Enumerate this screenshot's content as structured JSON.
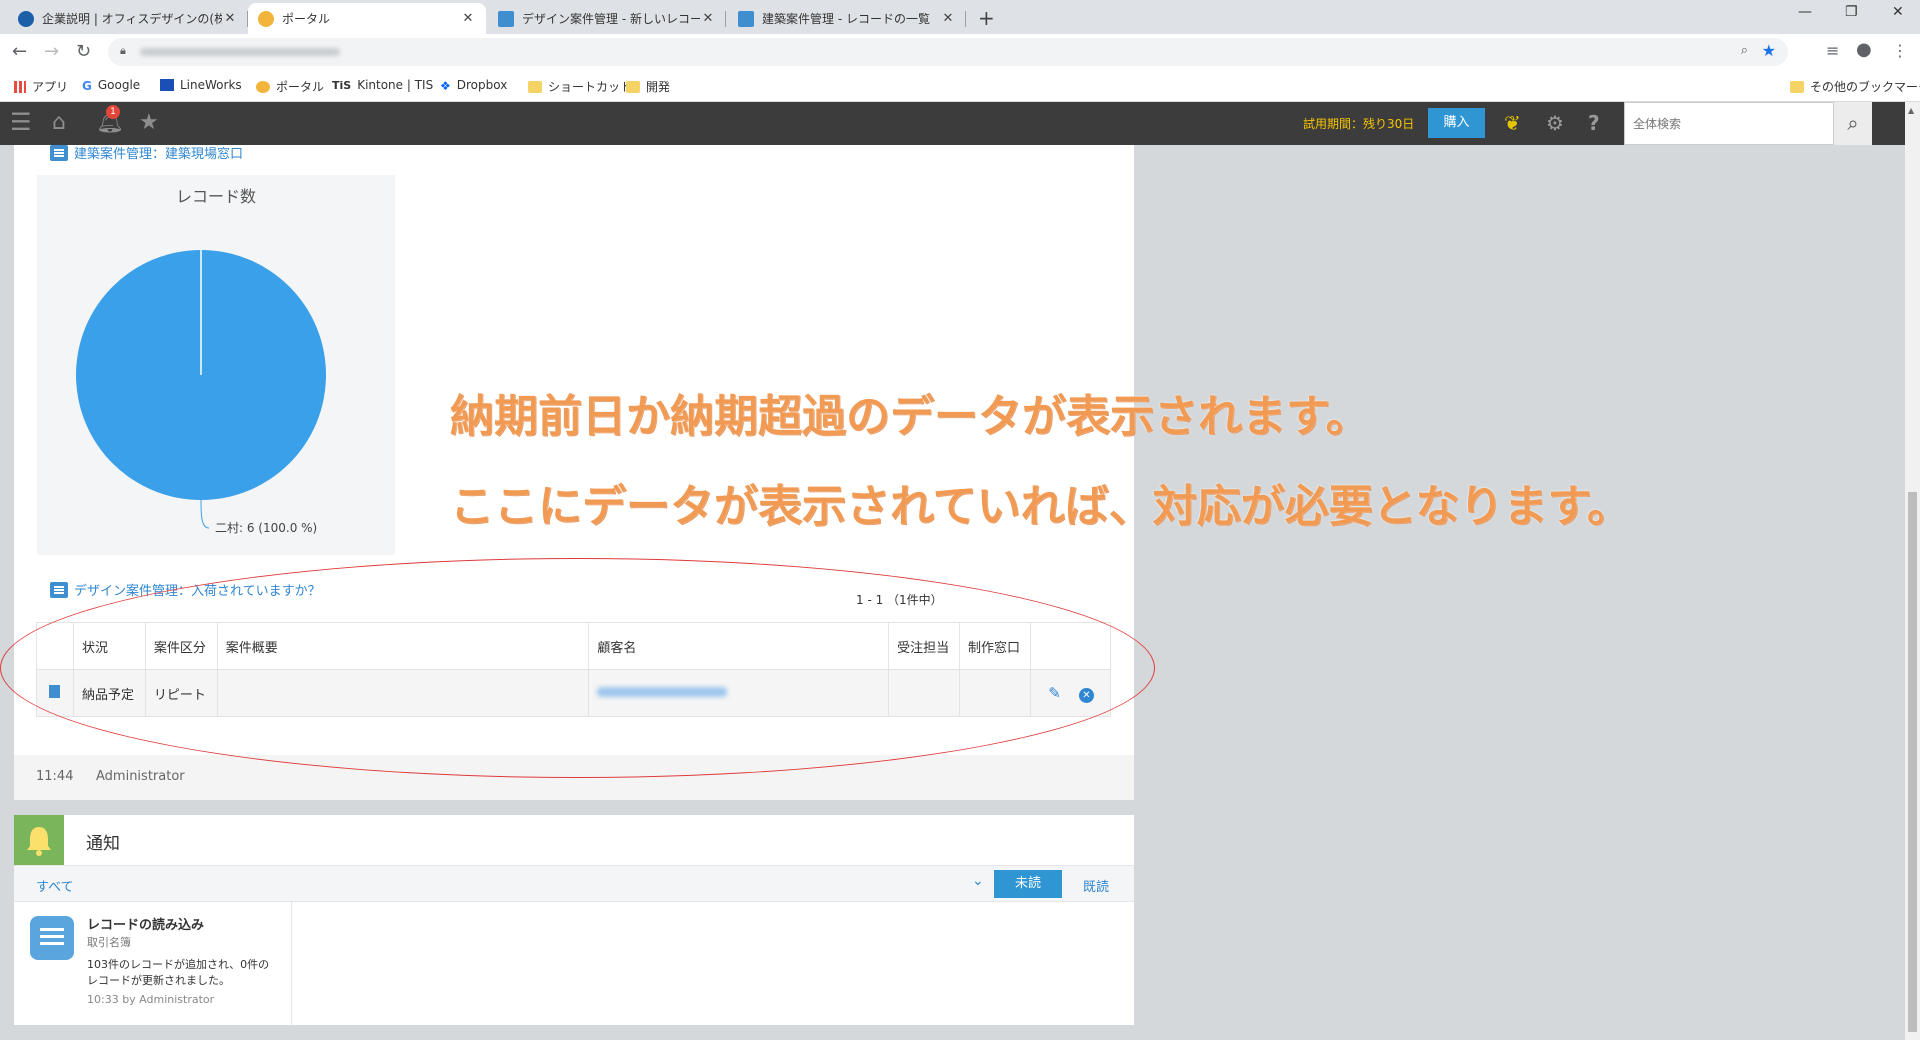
{
  "browser": {
    "tabs": [
      {
        "title": "企業説明 | オフィスデザインの(株)ス",
        "icon_color": "#1a5fa8",
        "active": false
      },
      {
        "title": "ポータル",
        "icon_color": "#f2b43b",
        "active": true
      },
      {
        "title": "デザイン案件管理 - 新しいレコード",
        "icon_color": "#3e8ed0",
        "active": false
      },
      {
        "title": "建築案件管理 - レコードの一覧",
        "icon_color": "#3e8ed0",
        "active": false
      }
    ],
    "bookmarks": [
      "アプリ",
      "Google",
      "LineWorks",
      "ポータル",
      "Kintone | TIS",
      "Dropbox",
      "ショートカット",
      "開発"
    ],
    "other_bookmarks": "その他のブックマーク"
  },
  "kintone_header": {
    "notification_count": "1",
    "trial_text": "試用期間：残り30日",
    "buy_label": "購入",
    "search_placeholder": "全体検索"
  },
  "portal": {
    "chart_section_link": "建築案件管理：建築現場窓口",
    "chart_data": {
      "type": "pie",
      "title": "レコード数",
      "categories": [
        "二村"
      ],
      "values": [
        6
      ],
      "labels": [
        "二村: 6 (100.0 %)"
      ],
      "colors": [
        "#3aa0ea"
      ]
    },
    "list_section_link": "デザイン案件管理：入荷されていますか？",
    "page_count": "1 - 1 （1件中）",
    "table": {
      "columns": [
        "状況",
        "案件区分",
        "案件概要",
        "顧客名",
        "受注担当",
        "制作窓口"
      ],
      "rows": [
        {
          "status": "納品予定",
          "category": "リピート",
          "summary": "",
          "customer": "",
          "sales": "",
          "producer": ""
        }
      ]
    },
    "footer_time": "11:44",
    "footer_user": "Administrator"
  },
  "notifications": {
    "title": "通知",
    "filter_all": "すべて",
    "unread_label": "未読",
    "read_label": "既読",
    "item": {
      "title": "レコードの読み込み",
      "app": "取引名簿",
      "body_line1": "103件のレコードが追加され、0件の",
      "body_line2": "レコードが更新されました。",
      "meta": "10:33  by Administrator"
    }
  },
  "annotations": {
    "line1": "納期前日か納期超過のデータが表示されます。",
    "line2": "ここにデータが表示されていれば、対応が必要となります。"
  }
}
